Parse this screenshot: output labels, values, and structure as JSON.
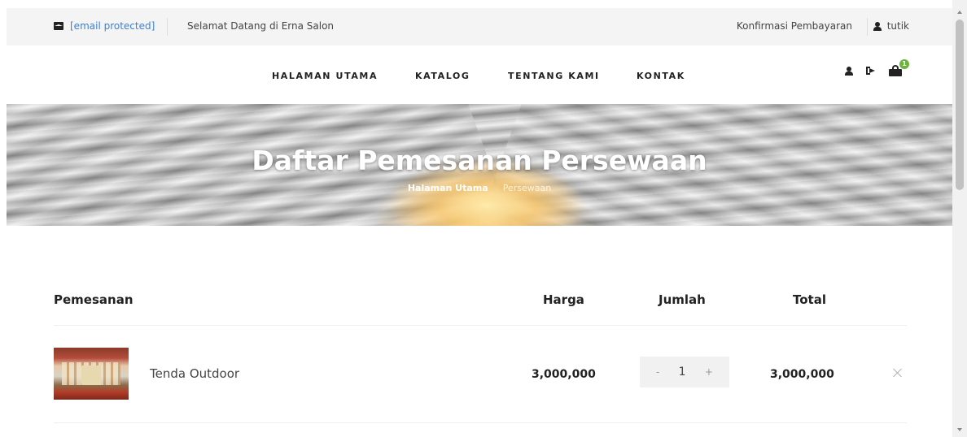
{
  "topbar": {
    "email": "[email protected]",
    "welcome": "Selamat Datang di Erna Salon",
    "confirm_payment": "Konfirmasi Pembayaran",
    "username": "tutik"
  },
  "nav": {
    "items": [
      "HALAMAN UTAMA",
      "KATALOG",
      "TENTANG KAMI",
      "KONTAK"
    ],
    "cart_count": "1"
  },
  "hero": {
    "title": "Daftar Pemesanan Persewaan",
    "breadcrumb_home": "Halaman Utama",
    "breadcrumb_current": "Persewaan"
  },
  "cart": {
    "columns": [
      "Pemesanan",
      "Harga",
      "Jumlah",
      "Total"
    ],
    "rows": [
      {
        "product": "Tenda Outdoor",
        "price": "3,000,000",
        "quantity": "1",
        "minus": "-",
        "plus": "+",
        "total": "3,000,000"
      }
    ]
  },
  "colors": {
    "link": "#3b82d6",
    "badge": "#6cb33f",
    "topbar_bg": "#f4f4f4"
  }
}
